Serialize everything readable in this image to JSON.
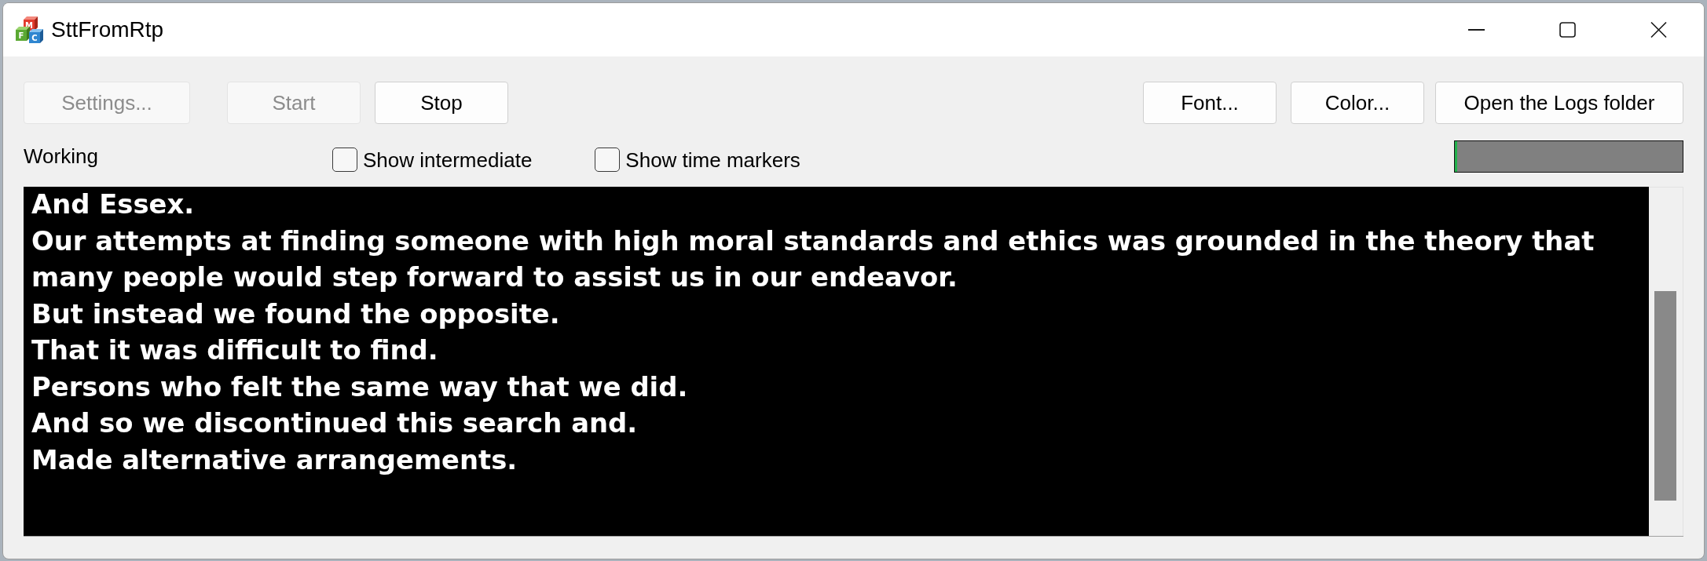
{
  "window": {
    "title": "SttFromRtp",
    "icon_letters": [
      "M",
      "F",
      "C"
    ]
  },
  "toolbar": {
    "left_buttons": [
      {
        "label": "Settings...",
        "disabled": true
      },
      {
        "label": "Start",
        "disabled": true
      },
      {
        "label": "Stop",
        "disabled": false
      }
    ],
    "right_buttons": [
      {
        "label": "Font...",
        "disabled": false
      },
      {
        "label": "Color...",
        "disabled": false
      },
      {
        "label": "Open the Logs folder",
        "disabled": false
      }
    ]
  },
  "status_row": {
    "status": "Working",
    "options": [
      {
        "label": "Show intermediate",
        "checked": false
      },
      {
        "label": "Show time markers",
        "checked": false
      }
    ],
    "input_meter": {
      "level": 0.01
    }
  },
  "transcript": {
    "lines": [
      "And Essex.",
      "Our attempts at finding someone with high moral standards and ethics was grounded in the theory that many people would step forward to assist us in our endeavor.",
      "But instead we found the opposite.",
      "That it was difficult to find.",
      "Persons who felt the same way that we did.",
      "And so we discontinued this search and.",
      "Made alternative arrangements."
    ]
  }
}
